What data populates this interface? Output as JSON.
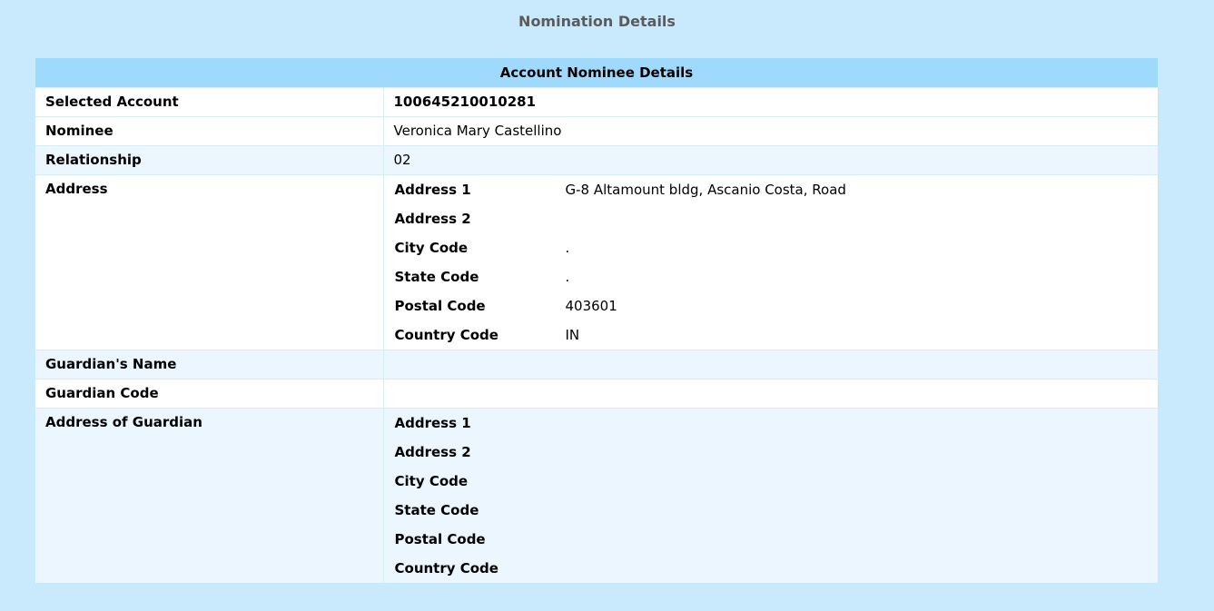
{
  "page": {
    "title": "Nomination Details"
  },
  "table": {
    "header": "Account Nominee Details",
    "selected_account": {
      "label": "Selected Account",
      "value": "100645210010281"
    },
    "nominee": {
      "label": "Nominee",
      "value": "Veronica Mary Castellino"
    },
    "relationship": {
      "label": "Relationship",
      "value": "02"
    },
    "address": {
      "label": "Address",
      "fields": [
        {
          "label": "Address 1",
          "value": "G-8 Altamount bldg, Ascanio Costa, Road"
        },
        {
          "label": "Address 2",
          "value": ""
        },
        {
          "label": "City Code",
          "value": "."
        },
        {
          "label": "State Code",
          "value": "."
        },
        {
          "label": "Postal Code",
          "value": "403601"
        },
        {
          "label": "Country Code",
          "value": "IN"
        }
      ]
    },
    "guardian_name": {
      "label": "Guardian's Name",
      "value": ""
    },
    "guardian_code": {
      "label": "Guardian Code",
      "value": ""
    },
    "guardian_address": {
      "label": "Address of Guardian",
      "fields": [
        {
          "label": "Address 1",
          "value": ""
        },
        {
          "label": "Address 2",
          "value": ""
        },
        {
          "label": "City Code",
          "value": ""
        },
        {
          "label": "State Code",
          "value": ""
        },
        {
          "label": "Postal Code",
          "value": ""
        },
        {
          "label": "Country Code",
          "value": ""
        }
      ]
    }
  },
  "colors": {
    "page_background": "#c9e9fd",
    "header_background": "#9fdafd",
    "row_light": "#ffffff",
    "row_alt": "#ebf6fe",
    "title_text": "#5b5b5b"
  }
}
